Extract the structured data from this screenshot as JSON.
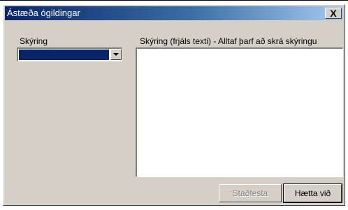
{
  "window": {
    "title": "Ástæða ógildingar",
    "close_label": "X"
  },
  "left": {
    "label": "Skýring",
    "combo_value": ""
  },
  "right": {
    "label": "Skýring (frjáls texti) - Alltaf þarf að skrá skýringu",
    "text_value": ""
  },
  "buttons": {
    "confirm_label": "Staðfesta",
    "cancel_label": "Hætta við"
  }
}
